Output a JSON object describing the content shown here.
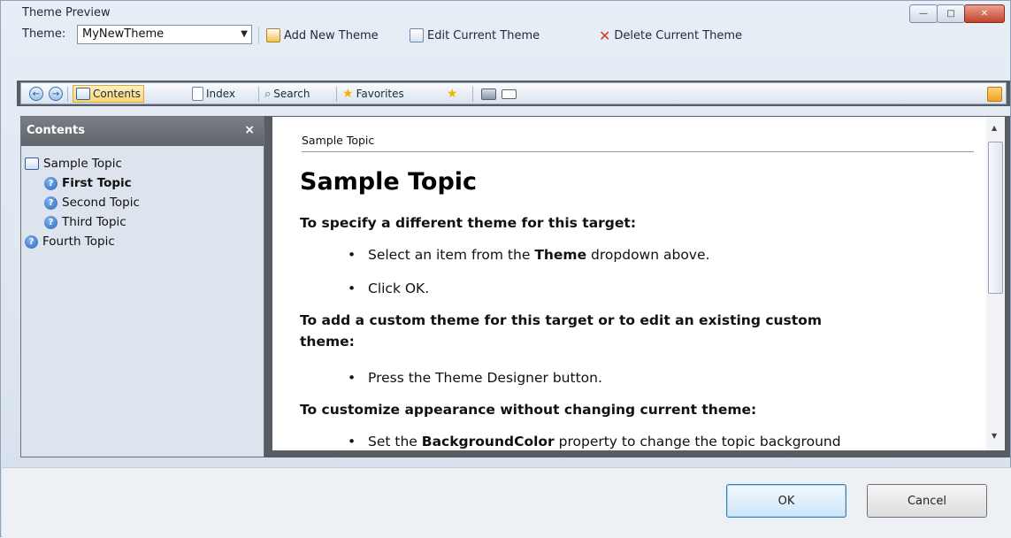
{
  "window": {
    "title": "Theme Preview",
    "minimize": "—",
    "maximize": "□",
    "close": "✕"
  },
  "theme_bar": {
    "label": "Theme:",
    "selected": "MyNewTheme",
    "add": "Add New Theme",
    "edit": "Edit Current Theme",
    "delete": "Delete Current Theme"
  },
  "nav": {
    "back": "←",
    "forward": "→",
    "contents": "Contents",
    "index": "Index",
    "search": "Search",
    "favorites": "Favorites"
  },
  "left_panel": {
    "title": "Contents",
    "close": "×",
    "tree": [
      {
        "label": "Sample Topic"
      },
      {
        "label": "First Topic"
      },
      {
        "label": "Second Topic"
      },
      {
        "label": "Third Topic"
      },
      {
        "label": "Fourth Topic"
      }
    ]
  },
  "topic": {
    "breadcrumb": "Sample Topic",
    "heading": "Sample Topic",
    "p1": "To specify a different theme for this target:",
    "b1_pre": "Select an item from the ",
    "b1_bold": "Theme",
    "b1_post": " dropdown above.",
    "b2": "Click OK.",
    "p2_line1": "To add a custom theme for this target or to edit an existing custom",
    "p2_line2": "theme:",
    "b3": "Press the Theme Designer button.",
    "p3": "To customize appearance without changing current theme:",
    "b4_pre": "Set the ",
    "b4_bold": "BackgroundColor",
    "b4_post": " property to change the topic background"
  },
  "buttons": {
    "ok": "OK",
    "cancel": "Cancel"
  },
  "colors": {
    "accent_orange": "#f3a21c",
    "close_red": "#c2442b",
    "panel_dark": "#585d63"
  }
}
